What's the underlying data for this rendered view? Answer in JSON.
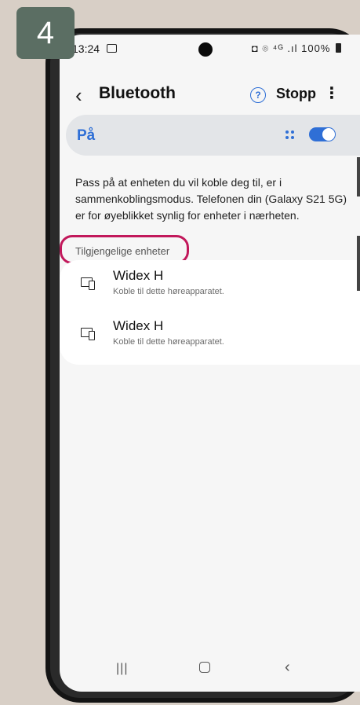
{
  "step_badge": "4",
  "statusbar": {
    "time": "13:24",
    "icons_text": "◘ ⌾ ⁴ᴳ .ıl",
    "battery": "100%"
  },
  "appbar": {
    "back_icon": "‹",
    "title": "Bluetooth",
    "help_icon": "?",
    "stop_label": "Stopp",
    "more_icon": "⋮"
  },
  "toggle": {
    "label": "På",
    "state": "on"
  },
  "info_text": "Pass på at enheten du vil koble deg til, er i sammenkoblingsmodus. Telefonen din (Galaxy S21 5G) er for øyeblikket synlig for enheter i nærheten.",
  "section_header": "Tilgjengelige enheter",
  "devices": [
    {
      "name": "Widex H",
      "subtitle": "Koble til dette høreapparatet."
    },
    {
      "name": "Widex H",
      "subtitle": "Koble til dette høreapparatet."
    }
  ],
  "navbar": {
    "recent_icon": "|||",
    "back_icon": "‹"
  },
  "colors": {
    "accent": "#2f6fd6",
    "highlight": "#c2185b",
    "badge": "#5b6e63",
    "background": "#d8cfc6"
  }
}
